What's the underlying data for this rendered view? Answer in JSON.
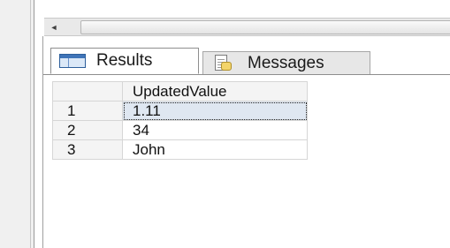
{
  "tabs": {
    "results_label": "Results",
    "messages_label": "Messages",
    "results_icon": "grid-icon",
    "messages_icon": "message-icon"
  },
  "results_grid": {
    "columns": [
      "UpdatedValue"
    ],
    "rows": [
      {
        "row_number": "1",
        "value": "1.11",
        "selected": true
      },
      {
        "row_number": "2",
        "value": "34"
      },
      {
        "row_number": "3",
        "value": "John"
      }
    ]
  },
  "scrollbar": {
    "left_arrow": "◄"
  }
}
